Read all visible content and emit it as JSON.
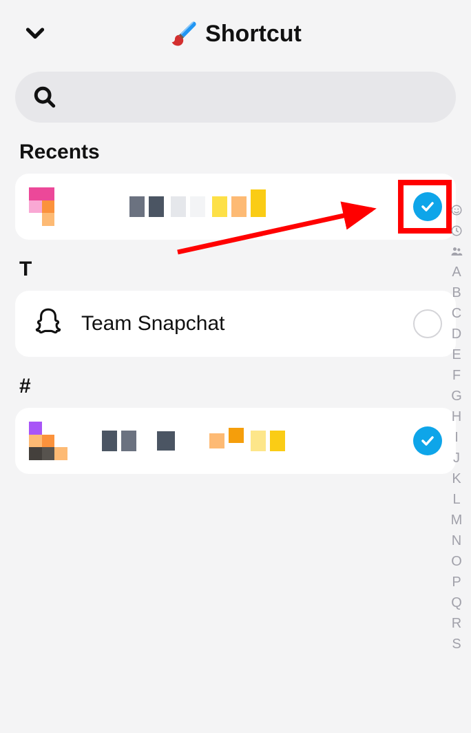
{
  "header": {
    "title": "Shortcut"
  },
  "search": {
    "placeholder": ""
  },
  "sections": {
    "recents_label": "Recents",
    "t_label": "T",
    "hash_label": "#"
  },
  "contacts": {
    "recent1": {
      "selected": true
    },
    "team": {
      "name": "Team Snapchat",
      "selected": false
    },
    "hash1": {
      "selected": true
    }
  },
  "alpha_index": [
    "A",
    "B",
    "C",
    "D",
    "E",
    "F",
    "G",
    "H",
    "I",
    "J",
    "K",
    "L",
    "M",
    "N",
    "O",
    "P",
    "Q",
    "R",
    "S"
  ]
}
